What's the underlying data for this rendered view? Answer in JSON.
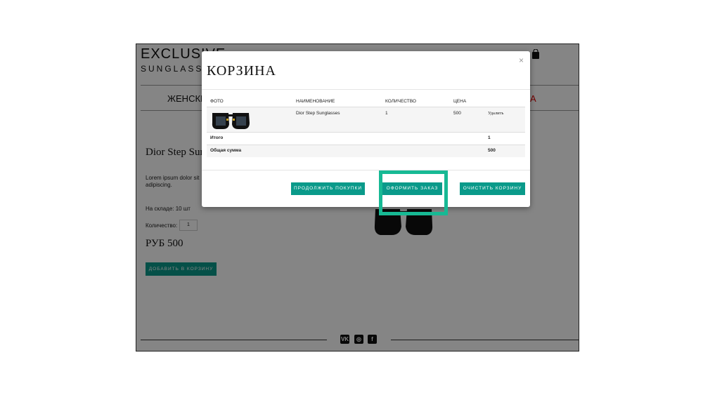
{
  "brand": {
    "title": "EXCLUSIVE",
    "subtitle": "SUNGLASSES"
  },
  "nav": {
    "women": "ЖЕНСКИЕ",
    "sale": "А"
  },
  "product": {
    "title": "Dior Step Sunglasses",
    "description": "Lorem ipsum dolor sit adipiscing.",
    "stock": "На складе: 10 шт",
    "quantity_label": "Количество:",
    "quantity_value": "1",
    "price": "РУБ 500",
    "add_to_cart": "ДОБАВИТЬ В КОРЗИНУ"
  },
  "social": {
    "vk": "VK",
    "instagram": "◎",
    "facebook": "f"
  },
  "modal": {
    "title": "КОРЗИНА",
    "close": "×",
    "headers": {
      "photo": "ФОТО",
      "name": "НАИМЕНОВАНИЕ",
      "quantity": "КОЛИЧЕСТВО",
      "price": "ЦЕНА"
    },
    "items": [
      {
        "name": "Dior Step Sunglasses",
        "quantity": "1",
        "price": "500",
        "remove": "Удалить"
      }
    ],
    "total_label": "Итого",
    "total_value": "1",
    "sum_label": "Общая сумма",
    "sum_value": "500",
    "buttons": {
      "continue": "ПРОДОЛЖИТЬ ПОКУПКИ",
      "checkout": "ОФОРМИТЬ ЗАКАЗ",
      "clear": "ОЧИСТИТЬ КОРЗИНУ"
    }
  },
  "colors": {
    "accent": "#0a9a8a",
    "highlight": "#17b994",
    "sale": "#dd0000"
  }
}
